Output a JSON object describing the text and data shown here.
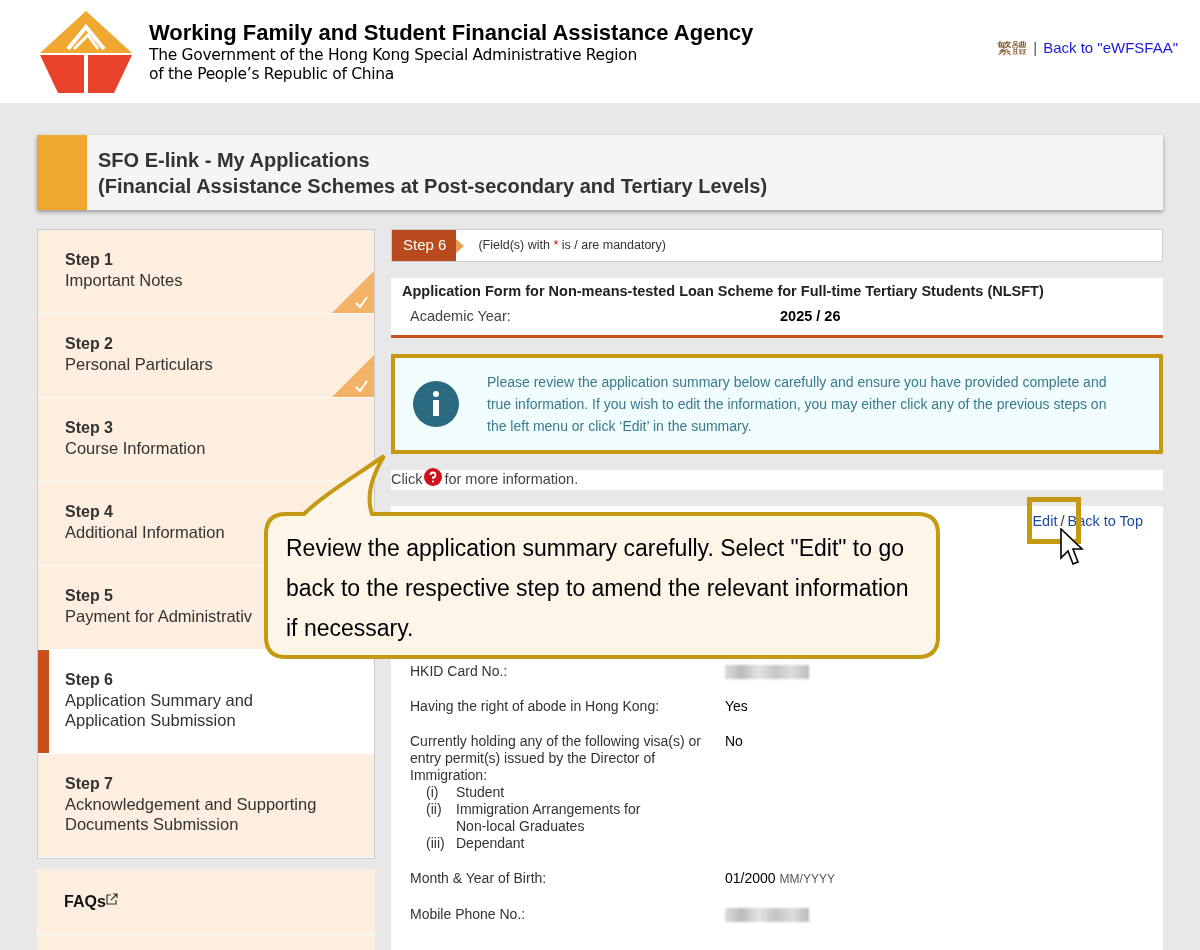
{
  "header": {
    "title": "Working Family and Student Financial Assistance Agency",
    "subtitle_lines": [
      "The Government of the Hong Kong Special Administrative Region",
      "of the People’s Republic of China"
    ],
    "links": [
      "繁體",
      "Back to \"eWFSFAA\""
    ],
    "separator": "|"
  },
  "page_title": [
    "SFO E-link - My Applications",
    "(Financial Assistance Schemes at Post-secondary and Tertiary Levels)"
  ],
  "sidebar": {
    "items": [
      {
        "step": "Step 1",
        "label": "Important Notes",
        "selected": false,
        "completed": true
      },
      {
        "step": "Step 2",
        "label": "Personal Particulars",
        "selected": false,
        "completed": true
      },
      {
        "step": "Step 3",
        "label": "Course Information",
        "selected": false,
        "completed": false
      },
      {
        "step": "Step 4",
        "label": "Additional Information",
        "selected": false,
        "completed": false
      },
      {
        "step": "Step 5",
        "label": "Payment for Administrativ",
        "selected": false,
        "completed": false
      },
      {
        "step": "Step 6",
        "label": "Application Summary and Application Submission",
        "selected": true,
        "completed": false
      },
      {
        "step": "Step 7",
        "label": "Acknowledgement and Supporting Documents Submission",
        "selected": false,
        "completed": false
      }
    ],
    "faqs": "FAQs"
  },
  "step_bar": {
    "badge": "Step 6",
    "note": "(Field(s) with * is / are mandatory)"
  },
  "form_header": {
    "title": "Application Form for Non-means-tested Loan Scheme for Full-time Tertiary Students (NLSFT)",
    "label": "Academic Year:",
    "value": "2025 / 26"
  },
  "info_box": "Please review the application summary below carefully and ensure you have provided complete and true information. If you wish to edit the information, you may either click any of the previous steps on the left menu or click ‘Edit’ in the summary.",
  "help_line": [
    "Click",
    "for more information."
  ],
  "summary": {
    "links": [
      "Edit",
      "/",
      "Back to Top"
    ],
    "rows": [
      {
        "label": "HKID Card No.:",
        "kind": "masked"
      },
      {
        "label": "Having the right of abode in Hong Kong:",
        "kind": "text",
        "value": "Yes"
      },
      {
        "label": "Currently holding any of the following visa(s) or entry permit(s) issued by the Director of Immigration:",
        "kind": "text",
        "value": "No",
        "list": [
          {
            "num": "(i)",
            "text": "Student"
          },
          {
            "num": "(ii)",
            "text": "Immigration Arrangements for Non-local Graduates"
          },
          {
            "num": "(iii)",
            "text": "Dependant"
          }
        ]
      },
      {
        "label": "Month & Year of Birth:",
        "kind": "text",
        "value": "01/2000",
        "hint": "MM/YYYY"
      },
      {
        "label": "Mobile Phone No.:",
        "kind": "masked"
      }
    ]
  },
  "callout": "Review the application summary carefully. Select \"Edit\" to go back to the respective step to amend the relevant information if necessary."
}
